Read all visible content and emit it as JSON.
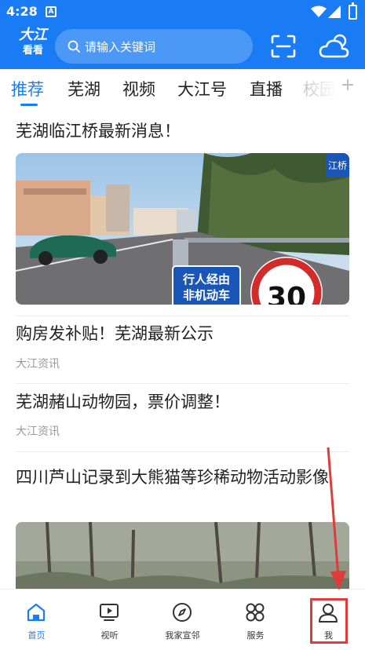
{
  "status_bar": {
    "time": "4:28",
    "notif_icon": "A"
  },
  "header": {
    "logo_line1": "大江",
    "logo_line2": "看看",
    "search_placeholder": "请输入关键词",
    "brand_color": "#1a7cf5"
  },
  "tabs": [
    {
      "label": "推荐",
      "active": true
    },
    {
      "label": "芜湖"
    },
    {
      "label": "视频"
    },
    {
      "label": "大江号"
    },
    {
      "label": "直播"
    },
    {
      "label": "校园"
    }
  ],
  "tabs_more": "+",
  "feed": {
    "items": [
      {
        "title": "芜湖临江桥最新消息！",
        "image_desc": "street-bridge-photo",
        "sign_text_1": "行人经由",
        "sign_text_2": "非机动车",
        "speed_limit": "30",
        "side_sign": "江桥"
      },
      {
        "title": "购房发补贴！芜湖最新公示",
        "source": "大江资讯"
      },
      {
        "title": "芜湖赭山动物园，票价调整！",
        "source": "大江资讯"
      },
      {
        "title": "四川芦山记录到大熊猫等珍稀动物活动影像",
        "image_desc": "forest-photo"
      }
    ]
  },
  "bottom_nav": [
    {
      "label": "首页",
      "icon": "home-icon",
      "active": true
    },
    {
      "label": "视听",
      "icon": "tv-play-icon"
    },
    {
      "label": "我家宣邻",
      "icon": "compass-icon"
    },
    {
      "label": "服务",
      "icon": "grid-services-icon"
    },
    {
      "label": "我",
      "icon": "user-icon"
    }
  ]
}
